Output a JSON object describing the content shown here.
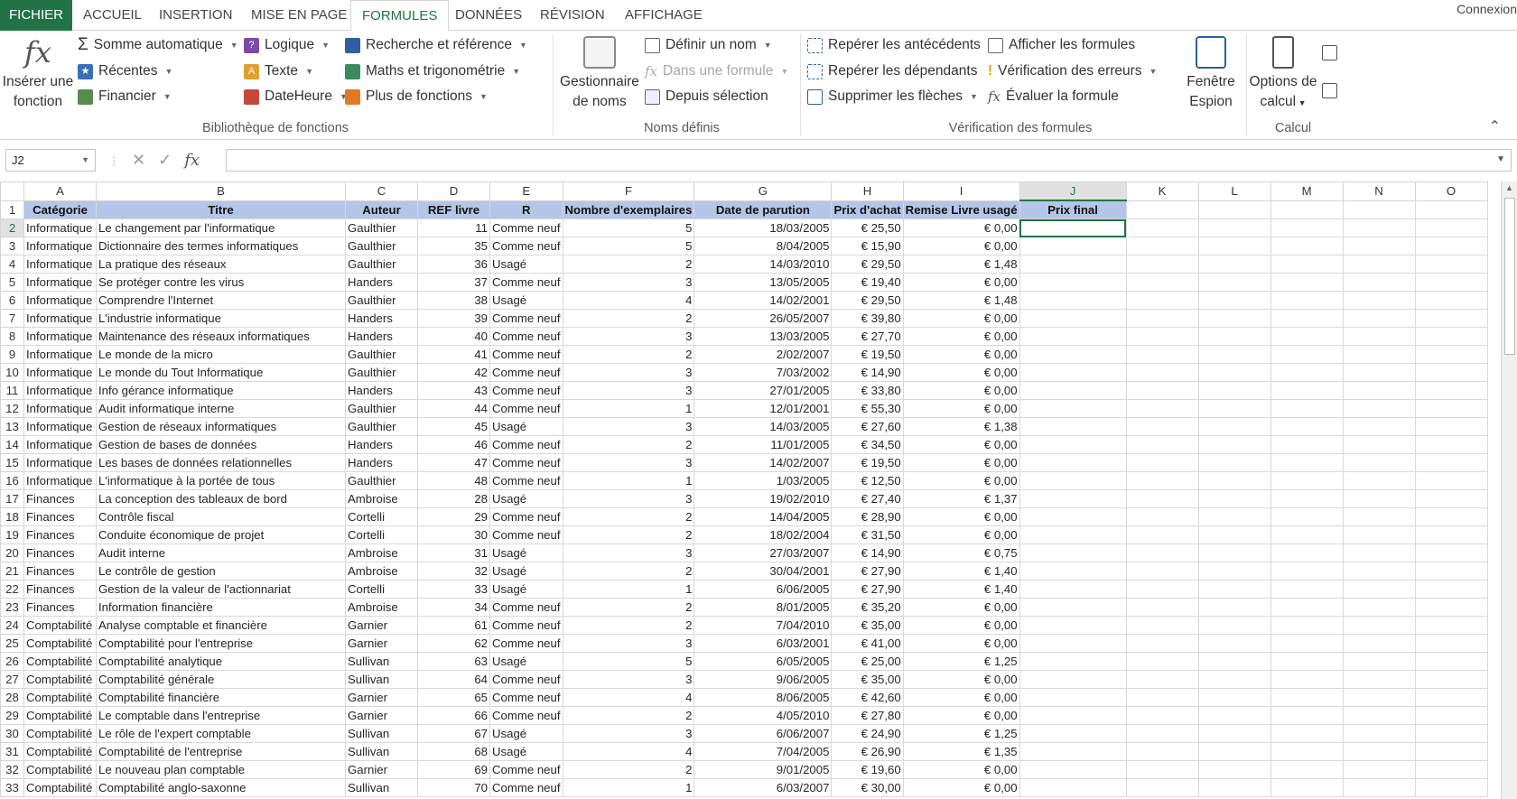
{
  "tabs": [
    "FICHIER",
    "ACCUEIL",
    "INSERTION",
    "MISE EN PAGE",
    "FORMULES",
    "DONNÉES",
    "RÉVISION",
    "AFFICHAGE"
  ],
  "user": "Connexion",
  "ribbon": {
    "insert_function": [
      "Insérer une",
      "fonction"
    ],
    "library": {
      "autosum": "Somme automatique",
      "recent": "Récentes",
      "financial": "Financier",
      "logical": "Logique",
      "text": "Texte",
      "datetime": "DateHeure",
      "lookup": "Recherche et référence",
      "math": "Maths et trigonométrie",
      "more": "Plus de fonctions",
      "group_label": "Bibliothèque de fonctions"
    },
    "names": {
      "manager": [
        "Gestionnaire",
        "de noms"
      ],
      "define": "Définir un nom",
      "use_in_formula": "Dans une formule",
      "from_selection": "Depuis sélection",
      "group_label": "Noms définis"
    },
    "audit": {
      "precedents": "Repérer les antécédents",
      "dependents": "Repérer les dépendants",
      "remove_arrows": "Supprimer les flèches",
      "show_formulas": "Afficher les formules",
      "error_check": "Vérification des erreurs",
      "evaluate": "Évaluer la formule",
      "watch": [
        "Fenêtre",
        "Espion"
      ],
      "group_label": "Vérification des formules"
    },
    "calc": {
      "options": [
        "Options de",
        "calcul"
      ],
      "group_label": "Calcul"
    }
  },
  "formula_bar": {
    "name_box": "J2",
    "fx": "fx",
    "value": ""
  },
  "sheet": {
    "columns": [
      "A",
      "B",
      "C",
      "D",
      "E",
      "F",
      "G",
      "H",
      "I",
      "J",
      "K",
      "L",
      "M",
      "N",
      "O"
    ],
    "selected_column": "J",
    "selected_row": 2,
    "headers": [
      "Catégorie",
      "Titre",
      "Auteur",
      "REF livre",
      "R",
      "Nombre d'exemplaires",
      "Date de parution",
      "Prix d'achat",
      "Remise Livre usagé",
      "Prix final"
    ],
    "rows": [
      [
        "Informatique",
        "Le changement par l'informatique",
        "Gaulthier",
        "11",
        "Comme neuf",
        "5",
        "18/03/2005",
        "€ 25,50",
        "€ 0,00"
      ],
      [
        "Informatique",
        "Dictionnaire des termes informatiques",
        "Gaulthier",
        "35",
        "Comme neuf",
        "5",
        "8/04/2005",
        "€ 15,90",
        "€ 0,00"
      ],
      [
        "Informatique",
        "La pratique des réseaux",
        "Gaulthier",
        "36",
        "Usagé",
        "2",
        "14/03/2010",
        "€ 29,50",
        "€ 1,48"
      ],
      [
        "Informatique",
        "Se protéger contre les virus",
        "Handers",
        "37",
        "Comme neuf",
        "3",
        "13/05/2005",
        "€ 19,40",
        "€ 0,00"
      ],
      [
        "Informatique",
        "Comprendre l'Internet",
        "Gaulthier",
        "38",
        "Usagé",
        "4",
        "14/02/2001",
        "€ 29,50",
        "€ 1,48"
      ],
      [
        "Informatique",
        "L'industrie informatique",
        "Handers",
        "39",
        "Comme neuf",
        "2",
        "26/05/2007",
        "€ 39,80",
        "€ 0,00"
      ],
      [
        "Informatique",
        "Maintenance des réseaux informatiques",
        "Handers",
        "40",
        "Comme neuf",
        "3",
        "13/03/2005",
        "€ 27,70",
        "€ 0,00"
      ],
      [
        "Informatique",
        "Le monde de la micro",
        "Gaulthier",
        "41",
        "Comme neuf",
        "2",
        "2/02/2007",
        "€ 19,50",
        "€ 0,00"
      ],
      [
        "Informatique",
        "Le monde du Tout Informatique",
        "Gaulthier",
        "42",
        "Comme neuf",
        "3",
        "7/03/2002",
        "€ 14,90",
        "€ 0,00"
      ],
      [
        "Informatique",
        "Info gérance informatique",
        "Handers",
        "43",
        "Comme neuf",
        "3",
        "27/01/2005",
        "€ 33,80",
        "€ 0,00"
      ],
      [
        "Informatique",
        "Audit informatique interne",
        "Gaulthier",
        "44",
        "Comme neuf",
        "1",
        "12/01/2001",
        "€ 55,30",
        "€ 0,00"
      ],
      [
        "Informatique",
        "Gestion de réseaux informatiques",
        "Gaulthier",
        "45",
        "Usagé",
        "3",
        "14/03/2005",
        "€ 27,60",
        "€ 1,38"
      ],
      [
        "Informatique",
        "Gestion de bases de données",
        "Handers",
        "46",
        "Comme neuf",
        "2",
        "11/01/2005",
        "€ 34,50",
        "€ 0,00"
      ],
      [
        "Informatique",
        "Les bases de données relationnelles",
        "Handers",
        "47",
        "Comme neuf",
        "3",
        "14/02/2007",
        "€ 19,50",
        "€ 0,00"
      ],
      [
        "Informatique",
        "L'informatique à la portée de tous",
        "Gaulthier",
        "48",
        "Comme neuf",
        "1",
        "1/03/2005",
        "€ 12,50",
        "€ 0,00"
      ],
      [
        "Finances",
        "La conception des tableaux de bord",
        "Ambroise",
        "28",
        "Usagé",
        "3",
        "19/02/2010",
        "€ 27,40",
        "€ 1,37"
      ],
      [
        "Finances",
        "Contrôle fiscal",
        "Cortelli",
        "29",
        "Comme neuf",
        "2",
        "14/04/2005",
        "€ 28,90",
        "€ 0,00"
      ],
      [
        "Finances",
        "Conduite économique de projet",
        "Cortelli",
        "30",
        "Comme neuf",
        "2",
        "18/02/2004",
        "€ 31,50",
        "€ 0,00"
      ],
      [
        "Finances",
        "Audit interne",
        "Ambroise",
        "31",
        "Usagé",
        "3",
        "27/03/2007",
        "€ 14,90",
        "€ 0,75"
      ],
      [
        "Finances",
        "Le contrôle de gestion",
        "Ambroise",
        "32",
        "Usagé",
        "2",
        "30/04/2001",
        "€ 27,90",
        "€ 1,40"
      ],
      [
        "Finances",
        "Gestion de la valeur de l'actionnariat",
        "Cortelli",
        "33",
        "Usagé",
        "1",
        "6/06/2005",
        "€ 27,90",
        "€ 1,40"
      ],
      [
        "Finances",
        "Information financière",
        "Ambroise",
        "34",
        "Comme neuf",
        "2",
        "8/01/2005",
        "€ 35,20",
        "€ 0,00"
      ],
      [
        "Comptabilité",
        "Analyse comptable et financière",
        "Garnier",
        "61",
        "Comme neuf",
        "2",
        "7/04/2010",
        "€ 35,00",
        "€ 0,00"
      ],
      [
        "Comptabilité",
        "Comptabilité pour l'entreprise",
        "Garnier",
        "62",
        "Comme neuf",
        "3",
        "6/03/2001",
        "€ 41,00",
        "€ 0,00"
      ],
      [
        "Comptabilité",
        "Comptabilité analytique",
        "Sullivan",
        "63",
        "Usagé",
        "5",
        "6/05/2005",
        "€ 25,00",
        "€ 1,25"
      ],
      [
        "Comptabilité",
        "Comptabilité générale",
        "Sullivan",
        "64",
        "Comme neuf",
        "3",
        "9/06/2005",
        "€ 35,00",
        "€ 0,00"
      ],
      [
        "Comptabilité",
        "Comptabilité financière",
        "Garnier",
        "65",
        "Comme neuf",
        "4",
        "8/06/2005",
        "€ 42,60",
        "€ 0,00"
      ],
      [
        "Comptabilité",
        "Le comptable dans l'entreprise",
        "Garnier",
        "66",
        "Comme neuf",
        "2",
        "4/05/2010",
        "€ 27,80",
        "€ 0,00"
      ],
      [
        "Comptabilité",
        "Le rôle de l'expert comptable",
        "Sullivan",
        "67",
        "Usagé",
        "3",
        "6/06/2007",
        "€ 24,90",
        "€ 1,25"
      ],
      [
        "Comptabilité",
        "Comptabilité de l'entreprise",
        "Sullivan",
        "68",
        "Usagé",
        "4",
        "7/04/2005",
        "€ 26,90",
        "€ 1,35"
      ],
      [
        "Comptabilité",
        "Le nouveau plan comptable",
        "Garnier",
        "69",
        "Comme neuf",
        "2",
        "9/01/2005",
        "€ 19,60",
        "€ 0,00"
      ],
      [
        "Comptabilité",
        "Comptabilité anglo-saxonne",
        "Sullivan",
        "70",
        "Comme neuf",
        "1",
        "6/03/2007",
        "€ 30,00",
        "€ 0,00"
      ]
    ]
  },
  "colors": {
    "accent": "#217346",
    "header_fill": "#b4c6e7"
  }
}
